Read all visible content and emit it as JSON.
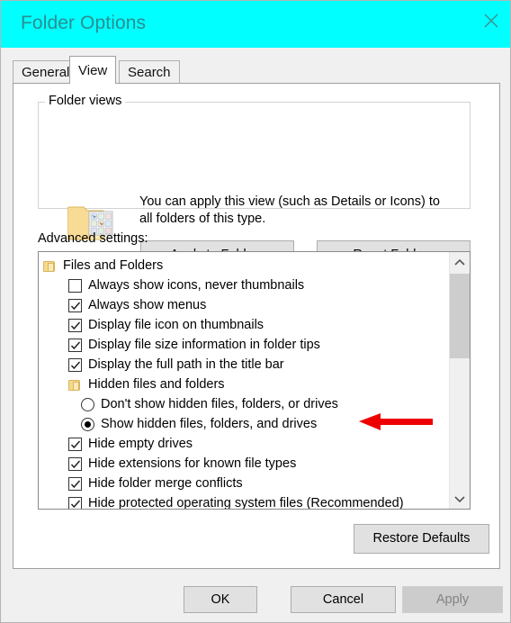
{
  "window": {
    "title": "Folder Options",
    "close_icon": "close-icon",
    "titlebar_color": "#00ffff",
    "title_text_color": "#2a8e91"
  },
  "tabs": [
    {
      "label": "General",
      "active": false
    },
    {
      "label": "View",
      "active": true
    },
    {
      "label": "Search",
      "active": false
    }
  ],
  "folder_views": {
    "legend": "Folder views",
    "icon": "folder-thumbnails-icon",
    "description_line1": "You can apply this view (such as Details or Icons) to",
    "description_line2": "all folders of this type.",
    "apply_button": "Apply to Folders",
    "reset_button": "Reset Folders"
  },
  "advanced": {
    "label": "Advanced settings:",
    "items": [
      {
        "type": "folder",
        "indent": 0,
        "label": "Files and Folders"
      },
      {
        "type": "checkbox",
        "indent": 1,
        "checked": false,
        "label": "Always show icons, never thumbnails"
      },
      {
        "type": "checkbox",
        "indent": 1,
        "checked": true,
        "label": "Always show menus"
      },
      {
        "type": "checkbox",
        "indent": 1,
        "checked": true,
        "label": "Display file icon on thumbnails"
      },
      {
        "type": "checkbox",
        "indent": 1,
        "checked": true,
        "label": "Display file size information in folder tips"
      },
      {
        "type": "checkbox",
        "indent": 1,
        "checked": true,
        "label": "Display the full path in the title bar"
      },
      {
        "type": "folder",
        "indent": 1,
        "label": "Hidden files and folders"
      },
      {
        "type": "radio",
        "indent": 2,
        "checked": false,
        "label": "Don't show hidden files, folders, or drives"
      },
      {
        "type": "radio",
        "indent": 2,
        "checked": true,
        "label": "Show hidden files, folders, and drives"
      },
      {
        "type": "checkbox",
        "indent": 1,
        "checked": true,
        "label": "Hide empty drives"
      },
      {
        "type": "checkbox",
        "indent": 1,
        "checked": true,
        "label": "Hide extensions for known file types"
      },
      {
        "type": "checkbox",
        "indent": 1,
        "checked": true,
        "label": "Hide folder merge conflicts"
      },
      {
        "type": "checkbox",
        "indent": 1,
        "checked": true,
        "label": "Hide protected operating system files (Recommended)"
      }
    ],
    "scrollbar": {
      "up_icon": "chevron-up-icon",
      "down_icon": "chevron-down-icon"
    }
  },
  "restore_defaults_button": "Restore Defaults",
  "footer": {
    "ok": "OK",
    "cancel": "Cancel",
    "apply": "Apply",
    "apply_disabled": true
  },
  "annotation": {
    "arrow_icon": "red-left-arrow-icon",
    "color": "#ee0000",
    "points_at": "Show hidden files, folders, and drives"
  }
}
